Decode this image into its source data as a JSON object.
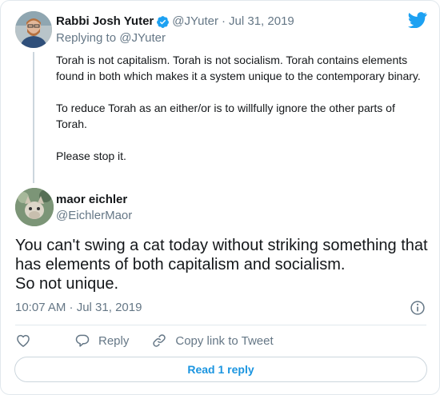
{
  "parent": {
    "name": "Rabbi Josh Yuter",
    "handle": "@JYuter",
    "separator": "·",
    "date": "Jul 31, 2019",
    "replying_to": "Replying to @JYuter",
    "paragraphs": [
      "Torah is not capitalism. Torah is not socialism. Torah contains elements found in both which makes it a system unique to the contemporary binary.",
      "To reduce Torah as an either/or is to willfully ignore the other parts of Torah.",
      "Please stop it."
    ]
  },
  "tweet": {
    "name": "maor eichler",
    "handle": "@EichlerMaor",
    "lines": [
      "You can't swing a cat today without striking something that",
      "has elements of both capitalism and socialism.",
      "So not unique."
    ],
    "timestamp": "10:07 AM · Jul 31, 2019"
  },
  "actions": {
    "reply_label": "Reply",
    "copy_label": "Copy link to Tweet"
  },
  "read_replies_label": "Read 1 reply",
  "colors": {
    "brand": "#1da1f2",
    "link": "#1b95e0",
    "muted": "#657786"
  },
  "icons": [
    "twitter-bird-icon",
    "verified-badge-icon",
    "info-icon",
    "heart-icon",
    "reply-icon",
    "link-icon"
  ]
}
